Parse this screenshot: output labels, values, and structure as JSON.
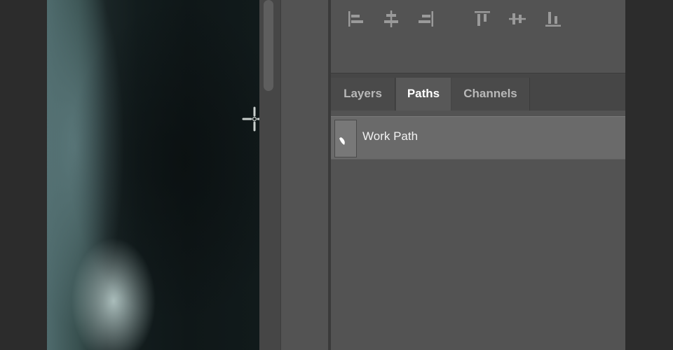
{
  "canvas": {
    "cursor_icon": "crosshair-icon"
  },
  "toolbar": {
    "align_icons": [
      "align-left-edges-icon",
      "align-horizontal-centers-icon",
      "align-right-edges-icon",
      "align-top-edges-icon",
      "align-vertical-centers-icon",
      "align-bottom-edges-icon"
    ]
  },
  "panel": {
    "tabs": [
      {
        "label": "Layers",
        "active": false
      },
      {
        "label": "Paths",
        "active": true
      },
      {
        "label": "Channels",
        "active": false
      }
    ],
    "paths": [
      {
        "name": "Work Path",
        "selected": true
      }
    ]
  },
  "colors": {
    "panel_bg": "#535353",
    "tab_strip_bg": "#464646",
    "selected_row": "#6a6a6a",
    "active_tab_text": "#ffffff"
  }
}
